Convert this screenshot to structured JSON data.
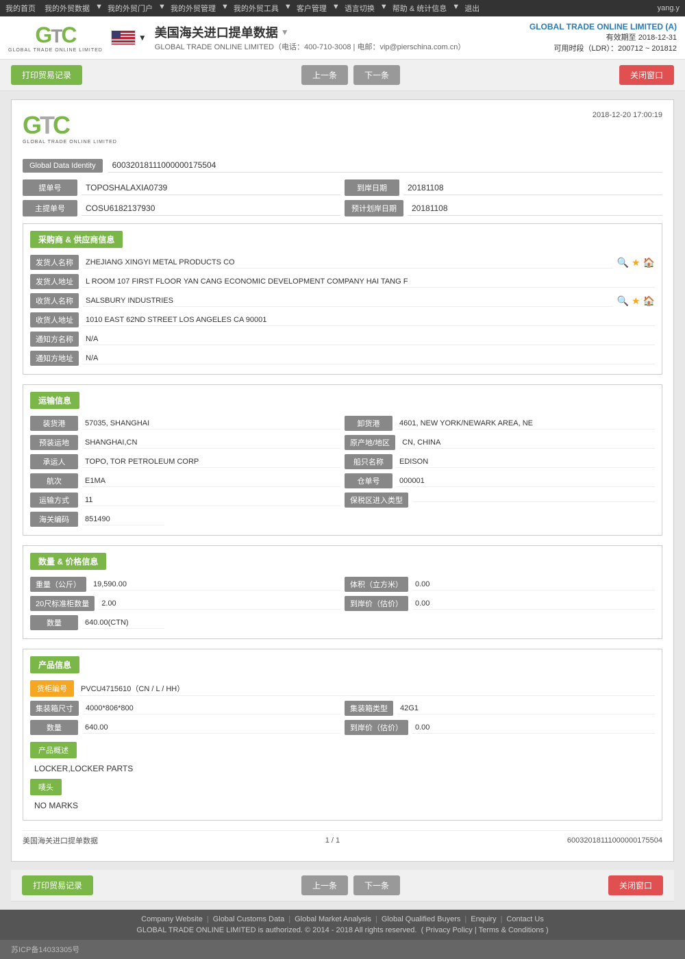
{
  "topnav": {
    "items": [
      "我的首页",
      "我的外贸数据",
      "我的外贸门户",
      "我的外贸管理",
      "我的外贸工具",
      "客户管理",
      "语言切换",
      "帮助 & 统计信息",
      "退出"
    ],
    "user": "yang.y"
  },
  "header": {
    "logo_text": "GTC",
    "logo_sub": "GLOBAL TRADE ONLINE LIMITED",
    "page_title": "美国海关进口提单数据",
    "page_title_arrow": "▼",
    "company_line": "GLOBAL TRADE ONLINE LIMITED（电话：400-710-3008 | 电邮：vip@pierschina.com.cn）",
    "company_top": "GLOBAL TRADE ONLINE LIMITED (A)",
    "valid_until": "有效期至 2018-12-31",
    "ldr": "可用时段（LDR）：200712 ~ 201812"
  },
  "toolbar": {
    "print_label": "打印贸易记录",
    "prev_label": "上一条",
    "next_label": "下一条",
    "close_label": "关闭窗口"
  },
  "document": {
    "logo_text": "GTC",
    "logo_sub": "GLOBAL TRADE ONLINE LIMITED",
    "datetime": "2018-12-20 17:00:19",
    "gdi_label": "Global Data Identity",
    "gdi_value": "60032018111000000175504",
    "bill_no_label": "提单号",
    "bill_no_value": "TOPOSHALAXIA0739",
    "main_bill_label": "主提单号",
    "main_bill_value": "COSU6182137930",
    "arrive_date_label": "到岸日期",
    "arrive_date_value": "20181108",
    "est_arrive_label": "预计划岸日期",
    "est_arrive_value": "20181108"
  },
  "buyer_supplier": {
    "section_title": "采购商 & 供应商信息",
    "sender_name_label": "发货人名称",
    "sender_name_value": "ZHEJIANG XINGYI METAL PRODUCTS CO",
    "sender_addr_label": "发货人地址",
    "sender_addr_value": "L ROOM 107 FIRST FLOOR YAN CANG ECONOMIC DEVELOPMENT COMPANY HAI TANG F",
    "receiver_name_label": "收货人名称",
    "receiver_name_value": "SALSBURY INDUSTRIES",
    "receiver_addr_label": "收货人地址",
    "receiver_addr_value": "1010 EAST 62ND STREET LOS ANGELES CA 90001",
    "notify_name_label": "通知方名称",
    "notify_name_value": "N/A",
    "notify_addr_label": "通知方地址",
    "notify_addr_value": "N/A"
  },
  "transport": {
    "section_title": "运输信息",
    "load_port_label": "装货港",
    "load_port_value": "57035, SHANGHAI",
    "unload_port_label": "卸货港",
    "unload_port_value": "4601, NEW YORK/NEWARK AREA, NE",
    "preload_label": "预装运地",
    "preload_value": "SHANGHAI,CN",
    "origin_label": "原产地/地区",
    "origin_value": "CN, CHINA",
    "carrier_label": "承运人",
    "carrier_value": "TOPO, TOR PETROLEUM CORP",
    "vessel_label": "船只名称",
    "vessel_value": "EDISON",
    "voyage_label": "航次",
    "voyage_value": "E1MA",
    "warehouse_label": "仓单号",
    "warehouse_value": "000001",
    "transport_mode_label": "运输方式",
    "transport_mode_value": "11",
    "bonded_label": "保税区进入类型",
    "bonded_value": "",
    "hs_code_label": "海关编码",
    "hs_code_value": "851490"
  },
  "quantity_price": {
    "section_title": "数量 & 价格信息",
    "weight_label": "重量（公斤）",
    "weight_value": "19,590.00",
    "volume_label": "体积（立方米）",
    "volume_value": "0.00",
    "container20_label": "20尺标准柜数量",
    "container20_value": "2.00",
    "arrive_price_label": "到岸价（估价）",
    "arrive_price_value": "0.00",
    "quantity_label": "数量",
    "quantity_value": "640.00(CTN)"
  },
  "product_info": {
    "section_title": "产品信息",
    "container_no_label": "货柜编号",
    "container_no_value": "PVCU4715610（CN / L / HH）",
    "container_size_label": "集装箱尺寸",
    "container_size_value": "4000*806*800",
    "container_type_label": "集装箱类型",
    "container_type_value": "42G1",
    "quantity_label": "数量",
    "quantity_value": "640.00",
    "arrive_price_label": "到岸价（估价）",
    "arrive_price_value": "0.00",
    "product_desc_label": "产品概述",
    "product_desc_value": "LOCKER,LOCKER PARTS",
    "mark_label": "唛头",
    "mark_value": "NO MARKS"
  },
  "doc_footer": {
    "source": "美国海关进口提单数据",
    "pagination": "1 / 1",
    "record_id": "60032018111000000175504"
  },
  "bottom_toolbar": {
    "print_label": "打印贸易记录",
    "prev_label": "上一条",
    "next_label": "下一条",
    "close_label": "关闭窗口"
  },
  "footer": {
    "links": [
      "Company Website",
      "Global Customs Data",
      "Global Market Analysis",
      "Global Qualified Buyers",
      "Enquiry",
      "Contact Us"
    ],
    "copyright": "GLOBAL TRADE ONLINE LIMITED is authorized. © 2014 - 2018 All rights reserved.",
    "privacy": "Privacy Policy",
    "terms": "Terms & Conditions",
    "icp": "苏ICP备14033305号"
  }
}
